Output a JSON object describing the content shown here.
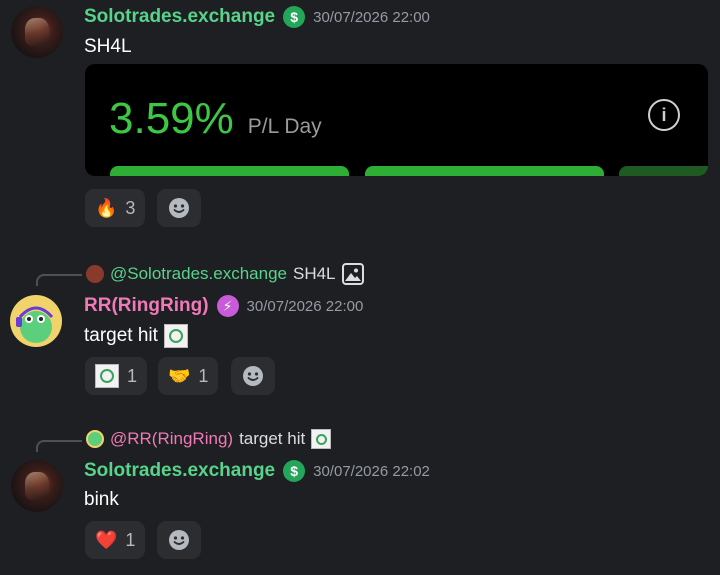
{
  "messages": [
    {
      "author": "Solotrades.exchange",
      "badge": "$",
      "timestamp": "30/07/2026 22:00",
      "text": "SH4L",
      "card": {
        "value": "3.59%",
        "label": "P/L Day"
      },
      "reactions": [
        {
          "emoji": "🔥",
          "count": "3"
        }
      ]
    },
    {
      "reply": {
        "author": "@Solotrades.exchange",
        "text": "SH4L"
      },
      "author": "RR(RingRing)",
      "badge": "⚡",
      "timestamp": "30/07/2026 22:00",
      "text": "target hit",
      "reactions": [
        {
          "emoji": "stamp",
          "count": "1"
        },
        {
          "emoji": "🤝",
          "count": "1"
        }
      ]
    },
    {
      "reply": {
        "author": "@RR(RingRing)",
        "text": "target hit"
      },
      "author": "Solotrades.exchange",
      "badge": "$",
      "timestamp": "30/07/2026 22:02",
      "text": "bink",
      "reactions": [
        {
          "emoji": "❤️",
          "count": "1"
        }
      ]
    }
  ],
  "colors": {
    "background": "#1e1f22",
    "solo_name": "#57d38a",
    "rr_name": "#f07ab6",
    "pl_green": "#3dc843"
  }
}
